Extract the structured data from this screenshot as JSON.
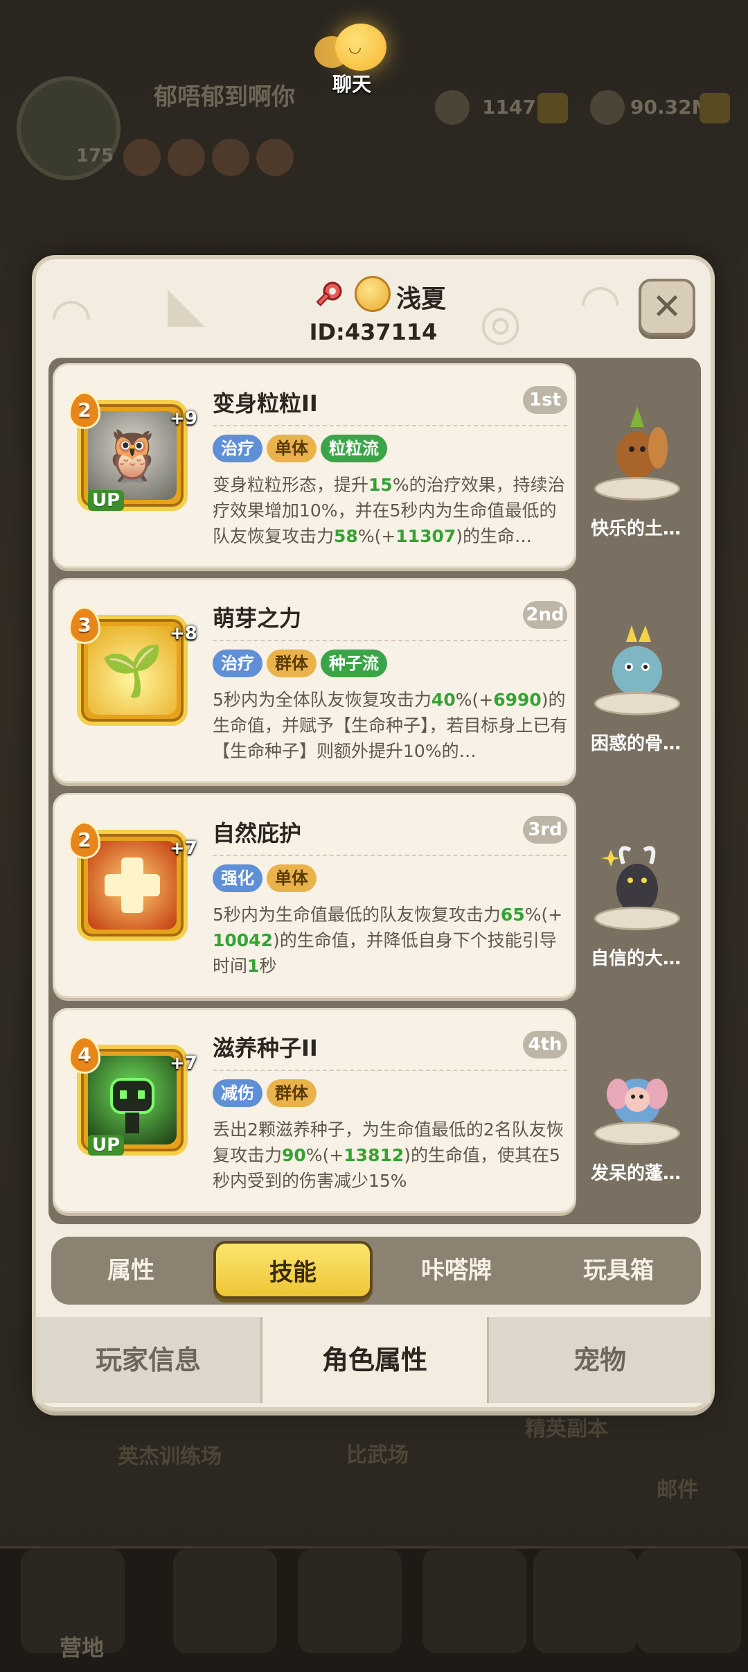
{
  "chat": {
    "label": "聊天"
  },
  "background": {
    "status_text": "郁唔郁到啊你",
    "level": "175",
    "resource_1": "1147",
    "resource_2": "90.32M",
    "floor_labels": [
      "英杰训练场",
      "比武场",
      "精英副本",
      "邮件"
    ],
    "nav_labels": [
      "营地"
    ]
  },
  "profile": {
    "name": "浅夏",
    "id": "ID:437114"
  },
  "skills": [
    {
      "title": "变身粒粒II",
      "rank": "1st",
      "level": "2",
      "plus": "+9",
      "up": "UP",
      "tags": [
        {
          "text": "治疗",
          "color": "blue"
        },
        {
          "text": "单体",
          "color": "orange"
        },
        {
          "text": "粒粒流",
          "color": "green"
        }
      ],
      "desc": [
        {
          "t": "变身粒粒形态，提升"
        },
        {
          "t": "15",
          "hl": true
        },
        {
          "t": "%的治疗效果，持续治疗效果增加10%，并在5秒内为生命值最低的队友恢复攻击力"
        },
        {
          "t": "58",
          "hl": true
        },
        {
          "t": "%(+"
        },
        {
          "t": "11307",
          "hl": true
        },
        {
          "t": ")的生命…"
        }
      ],
      "icon": "owl-skill-icon",
      "icon_bg": "#8a8a80"
    },
    {
      "title": "萌芽之力",
      "rank": "2nd",
      "level": "3",
      "plus": "+8",
      "up": "",
      "tags": [
        {
          "text": "治疗",
          "color": "blue"
        },
        {
          "text": "群体",
          "color": "orange"
        },
        {
          "text": "种子流",
          "color": "green"
        }
      ],
      "desc": [
        {
          "t": "5秒内为全体队友恢复攻击力"
        },
        {
          "t": "40",
          "hl": true
        },
        {
          "t": "%(+"
        },
        {
          "t": "6990",
          "hl": true
        },
        {
          "t": ")的生命值，并赋予【生命种子】，若目标身上已有【生命种子】则额外提升10%的…"
        }
      ],
      "icon": "sprout-skill-icon",
      "icon_bg": "#d9a820"
    },
    {
      "title": "自然庇护",
      "rank": "3rd",
      "level": "2",
      "plus": "+7",
      "up": "",
      "tags": [
        {
          "text": "强化",
          "color": "blue"
        },
        {
          "text": "单体",
          "color": "orange"
        }
      ],
      "desc": [
        {
          "t": "5秒内为生命值最低的队友恢复攻击力"
        },
        {
          "t": "65",
          "hl": true
        },
        {
          "t": "%(+"
        },
        {
          "t": "10042",
          "hl": true
        },
        {
          "t": ")的生命值，并降低自身下个技能引导时间"
        },
        {
          "t": "1",
          "hl": true
        },
        {
          "t": "秒"
        }
      ],
      "icon": "heal-cross-skill-icon",
      "icon_bg": "#d8541a"
    },
    {
      "title": "滋养种子II",
      "rank": "4th",
      "level": "4",
      "plus": "+7",
      "up": "UP",
      "tags": [
        {
          "text": "减伤",
          "color": "blue"
        },
        {
          "text": "群体",
          "color": "orange"
        }
      ],
      "desc": [
        {
          "t": "丢出2颗滋养种子，为生命值最低的2名队友恢复攻击力"
        },
        {
          "t": "90",
          "hl": true
        },
        {
          "t": "%(+"
        },
        {
          "t": "13812",
          "hl": true
        },
        {
          "t": ")的生命值，使其在5秒内受到的伤害减少15%"
        }
      ],
      "icon": "seed-robot-skill-icon",
      "icon_bg": "#2f5a22"
    }
  ],
  "pets": [
    {
      "name": "快乐的土…",
      "icon": "squirrel-pet-icon",
      "color": "#a8642a"
    },
    {
      "name": "困惑的骨…",
      "icon": "dragon-pet-icon",
      "color": "#7fb6c4"
    },
    {
      "name": "自信的大…",
      "icon": "goat-pet-icon",
      "color": "#3c3a40"
    },
    {
      "name": "发呆的蓬…",
      "icon": "elephant-pet-icon",
      "color": "#6fa6d6"
    }
  ],
  "sub_tabs": [
    {
      "label": "属性",
      "active": false
    },
    {
      "label": "技能",
      "active": true
    },
    {
      "label": "咔嗒牌",
      "active": false
    },
    {
      "label": "玩具箱",
      "active": false
    }
  ],
  "bottom_tabs": [
    {
      "label": "玩家信息",
      "active": false
    },
    {
      "label": "角色属性",
      "active": true
    },
    {
      "label": "宠物",
      "active": false
    }
  ]
}
